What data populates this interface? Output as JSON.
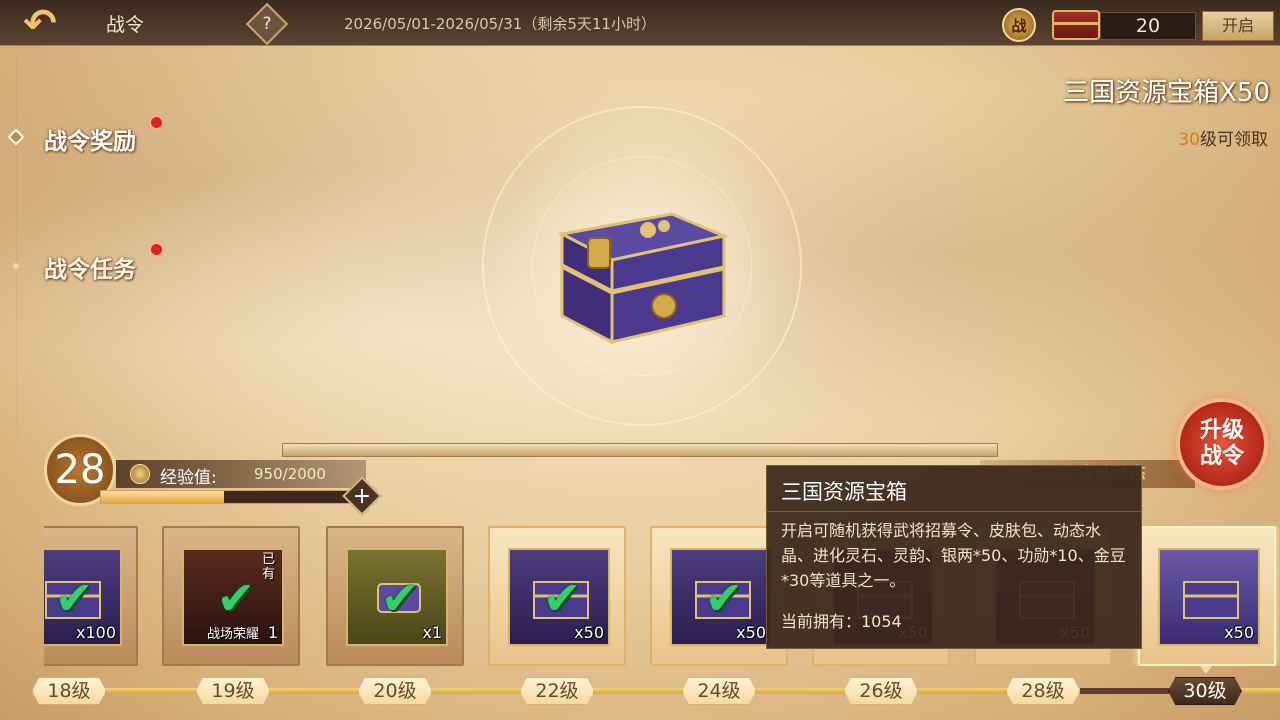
{
  "header": {
    "title": "战令",
    "help_label": "?",
    "date_range": "2026/05/01-2026/05/31（剩余5天11小时）",
    "badge_label": "战",
    "chest_count": "20",
    "open_label": "开启"
  },
  "sidebar": {
    "items": [
      {
        "label": "战令奖励",
        "active": true,
        "has_notification": true
      },
      {
        "label": "战令任务",
        "active": false,
        "has_notification": true
      }
    ]
  },
  "showcase": {
    "reward_title": "三国资源宝箱X50",
    "unlock_level": "30",
    "unlock_suffix": "级可领取"
  },
  "level_panel": {
    "current_level": "28",
    "exp_label": "经验值:",
    "exp_value": "950/2000",
    "exp_progress": 0.475,
    "plus_label": "+",
    "skin_banner": "必得限定皮肤动态",
    "upgrade_line1": "升级",
    "upgrade_line2": "战令"
  },
  "reward_track": [
    {
      "level": "18级",
      "qty": "x100",
      "claimed": true,
      "icon": "purple-chest-icon"
    },
    {
      "level": "19级",
      "qty": "1",
      "claimed": true,
      "icon": "battle-honor-icon",
      "label": "战场荣耀",
      "owned_tag": "已有"
    },
    {
      "level": "20级",
      "qty": "x1",
      "claimed": true,
      "icon": "scroll-icon"
    },
    {
      "level": "22级",
      "qty": "x50",
      "claimed": true,
      "icon": "purple-chest-icon"
    },
    {
      "level": "24级",
      "qty": "x50",
      "claimed": true,
      "icon": "purple-chest-icon"
    },
    {
      "level": "26级",
      "qty": "x50",
      "claimed": false,
      "icon": "purple-chest-icon"
    },
    {
      "level": "28级",
      "qty": "x50",
      "claimed": false,
      "icon": "purple-chest-icon"
    },
    {
      "level": "30级",
      "qty": "x50",
      "claimed": false,
      "icon": "purple-chest-icon",
      "current": true
    }
  ],
  "tooltip": {
    "title": "三国资源宝箱",
    "description": "开启可随机获得武将招募令、皮肤包、动态水晶、进化灵石、灵韵、银两*50、功勋*10、金豆*30等道具之一。",
    "owned_label": "当前拥有：1054"
  },
  "colors": {
    "accent_gold": "#e0b06c",
    "check_green": "#2fd16a",
    "notification_red": "#e2231a",
    "upgrade_red": "#b82a1a"
  }
}
